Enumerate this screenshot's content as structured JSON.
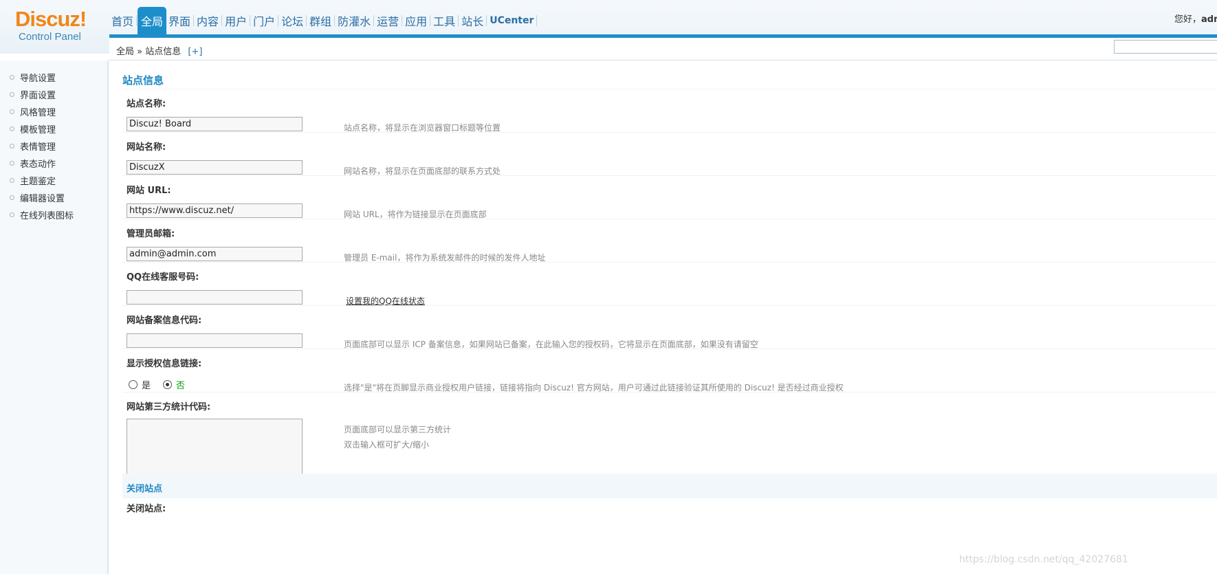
{
  "header": {
    "logo_text": "Discuz!",
    "logo_sub": "Control Panel",
    "nav": [
      {
        "label": "首页",
        "active": false
      },
      {
        "label": "全局",
        "active": true
      },
      {
        "label": "界面",
        "active": false
      },
      {
        "label": "内容",
        "active": false
      },
      {
        "label": "用户",
        "active": false
      },
      {
        "label": "门户",
        "active": false
      },
      {
        "label": "论坛",
        "active": false
      },
      {
        "label": "群组",
        "active": false
      },
      {
        "label": "防灌水",
        "active": false
      },
      {
        "label": "运营",
        "active": false
      },
      {
        "label": "应用",
        "active": false
      },
      {
        "label": "工具",
        "active": false
      },
      {
        "label": "站长",
        "active": false
      },
      {
        "label": "UCenter",
        "active": false
      }
    ],
    "greeting": "您好，",
    "username": "adm"
  },
  "breadcrumb": {
    "root": "全局",
    "sep": "»",
    "current": "站点信息",
    "plus": "[+]"
  },
  "sidebar": {
    "items": [
      {
        "label": "导航设置"
      },
      {
        "label": "界面设置"
      },
      {
        "label": "风格管理"
      },
      {
        "label": "模板管理"
      },
      {
        "label": "表情管理"
      },
      {
        "label": "表态动作"
      },
      {
        "label": "主题鉴定"
      },
      {
        "label": "编辑器设置"
      },
      {
        "label": "在线列表图标"
      }
    ]
  },
  "main": {
    "section_title": "站点信息",
    "fields": {
      "site_name": {
        "label": "站点名称:",
        "value": "Discuz! Board",
        "hint": "站点名称，将显示在浏览器窗口标题等位置"
      },
      "web_name": {
        "label": "网站名称:",
        "value": "DiscuzX",
        "hint": "网站名称，将显示在页面底部的联系方式处"
      },
      "web_url": {
        "label": "网站 URL:",
        "value": "https://www.discuz.net/",
        "hint": "网站 URL，将作为链接显示在页面底部"
      },
      "admin_email": {
        "label": "管理员邮箱:",
        "value": "admin@admin.com",
        "hint": "管理员 E-mail，将作为系统发邮件的时候的发件人地址"
      },
      "qq": {
        "label": "QQ在线客服号码:",
        "value": "",
        "link": "设置我的QQ在线状态"
      },
      "icp": {
        "label": "网站备案信息代码:",
        "value": "",
        "hint": "页面底部可以显示 ICP 备案信息，如果网站已备案，在此输入您的授权码，它将显示在页面底部，如果没有请留空"
      },
      "license_link": {
        "label": "显示授权信息链接:",
        "yes": "是",
        "no": "否",
        "selected": "否",
        "hint": "选择\"是\"将在页脚显示商业授权用户链接，链接将指向 Discuz! 官方网站，用户可通过此链接验证其所使用的 Discuz! 是否经过商业授权"
      },
      "stats_code": {
        "label": "网站第三方统计代码:",
        "hint1": "页面底部可以显示第三方统计",
        "hint2": "双击输入框可扩大/缩小"
      }
    },
    "close_section": "关闭站点",
    "close_label": "关闭站点:"
  },
  "watermark": "https://blog.csdn.net/qq_42027681"
}
